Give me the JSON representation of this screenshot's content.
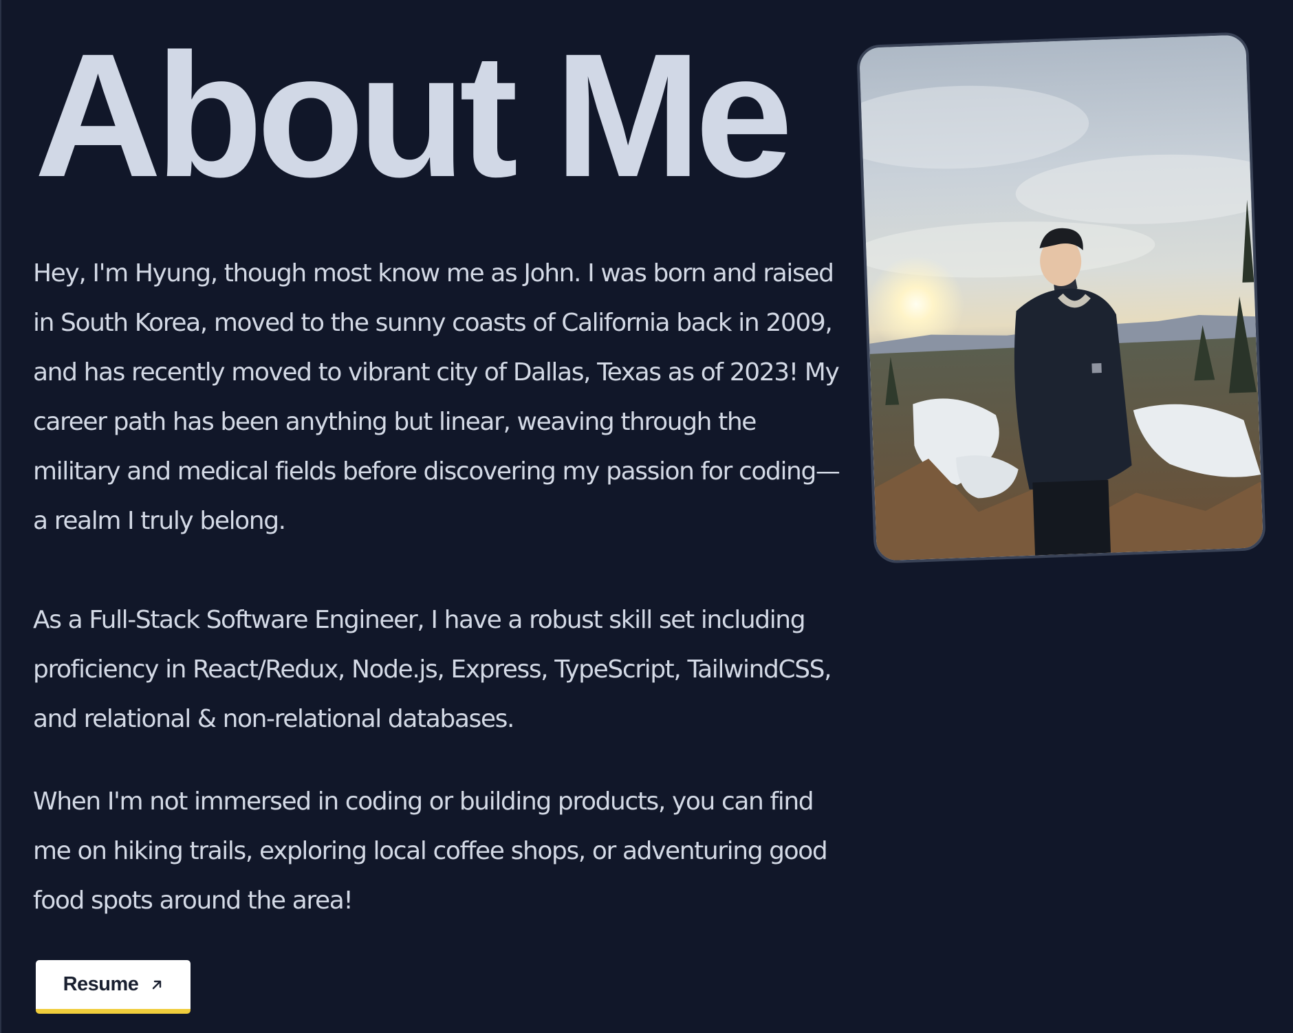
{
  "page": {
    "title": "About Me"
  },
  "bio": {
    "paragraph1": "Hey, I'm Hyung, though most know me as John. I was born and raised in South Korea, moved to the sunny coasts of California back in 2009, and has recently moved to vibrant city of Dallas, Texas as of 2023! My career path has been anything but linear, weaving through the military and medical fields before discovering my passion for coding—a realm I truly belong.",
    "paragraph2": "As a Full-Stack Software Engineer, I have a robust skill set including proficiency in React/Redux, Node.js, Express, TypeScript, TailwindCSS, and relational & non-relational databases.",
    "paragraph3": "When I'm not immersed in coding or building products, you can find me on hiking trails, exploring local coffee shops, or adventuring good food spots around the area!"
  },
  "resume_button": {
    "label": "Resume",
    "icon": "arrow-up-right-icon"
  },
  "profile_photo": {
    "icon": "profile-photo"
  },
  "colors": {
    "background": "#111729",
    "title": "#d1d8e6",
    "text": "#d4dae6",
    "button_bg": "#ffffff",
    "button_accent": "#f0cd3c",
    "frame_border": "#3a4357"
  }
}
